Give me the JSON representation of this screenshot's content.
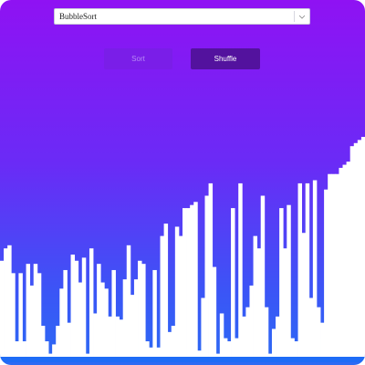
{
  "algorithm_select": {
    "selected": "BubbleSort",
    "chevron_icon": "chevron-down-icon"
  },
  "buttons": {
    "sort_label": "Sort",
    "shuffle_label": "Shuffle"
  },
  "colors": {
    "gradient_top": "#8f12f3",
    "gradient_bottom": "#2b6bf4",
    "bar_fill": "#ffffff",
    "sort_button_bg": "#7a1ee8",
    "shuffle_button_bg": "#53129e"
  },
  "array_values": [
    31,
    35,
    36,
    27,
    5,
    27,
    5,
    30,
    23,
    30,
    27,
    10,
    5,
    1,
    4,
    10,
    22,
    28,
    11,
    33,
    31,
    24,
    32,
    1,
    35,
    14,
    30,
    24,
    22,
    13,
    28,
    13,
    12,
    25,
    36,
    20,
    25,
    31,
    30,
    5,
    3,
    28,
    3,
    39,
    43,
    8,
    10,
    42,
    39,
    48,
    48,
    49,
    50,
    2,
    19,
    52,
    56,
    29,
    1,
    14,
    6,
    5,
    48,
    6,
    56,
    13,
    16,
    23,
    39,
    35,
    52,
    16,
    1,
    9,
    13,
    48,
    35,
    49,
    6,
    5,
    56,
    40,
    56,
    19,
    57,
    16,
    11,
    54,
    59,
    59,
    59,
    61,
    62,
    63,
    68,
    69,
    70,
    71
  ]
}
